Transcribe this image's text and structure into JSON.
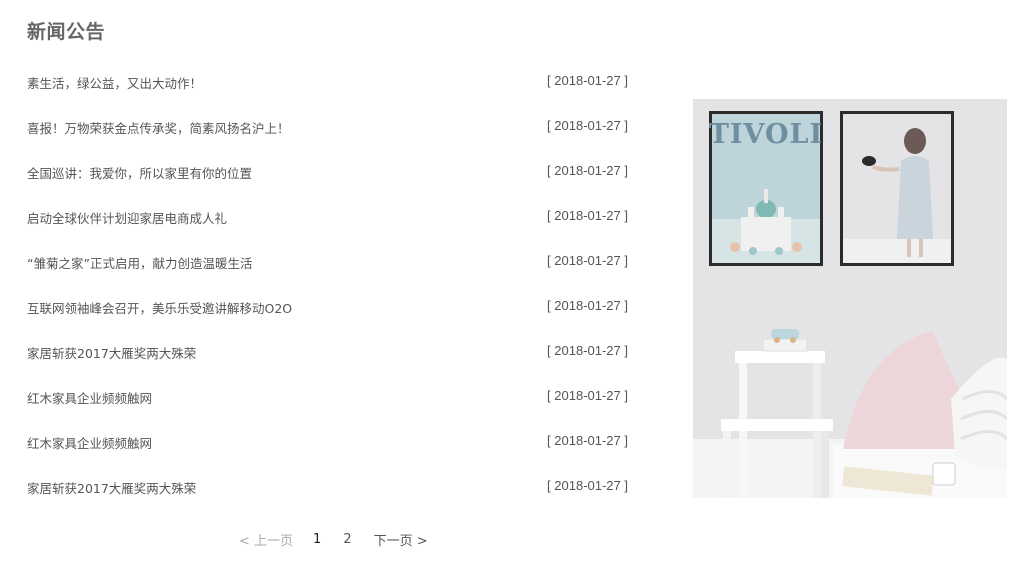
{
  "section": {
    "title": "新闻公告"
  },
  "news": [
    {
      "title": "素生活，绿公益，又出大动作！",
      "date": "[ 2018-01-27 ]"
    },
    {
      "title": "喜报！万物荣获金点传承奖，简素风扬名沪上！",
      "date": "[ 2018-01-27 ]"
    },
    {
      "title": "全国巡讲：我爱你，所以家里有你的位置",
      "date": "[ 2018-01-27 ]"
    },
    {
      "title": "启动全球伙伴计划迎家居电商成人礼",
      "date": "[ 2018-01-27 ]"
    },
    {
      "title": "“雏菊之家”正式启用，献力创造温暖生活",
      "date": "[ 2018-01-27 ]"
    },
    {
      "title": "互联网领袖峰会召开，美乐乐受邀讲解移动O2O",
      "date": "[ 2018-01-27 ]"
    },
    {
      "title": "家居斩获2017大雁奖两大殊荣",
      "date": "[ 2018-01-27 ]"
    },
    {
      "title": "红木家具企业频频触网",
      "date": "[ 2018-01-27 ]"
    },
    {
      "title": "红木家具企业频频触网",
      "date": "[ 2018-01-27 ]"
    },
    {
      "title": "家居斩获2017大雁奖两大殊荣",
      "date": "[ 2018-01-27 ]"
    }
  ],
  "pagination": {
    "prev": "< 上一页",
    "pages": [
      "1",
      "2"
    ],
    "current": "1",
    "next": "下一页 >"
  },
  "photo": {
    "poster_text": "TIVOLI"
  }
}
